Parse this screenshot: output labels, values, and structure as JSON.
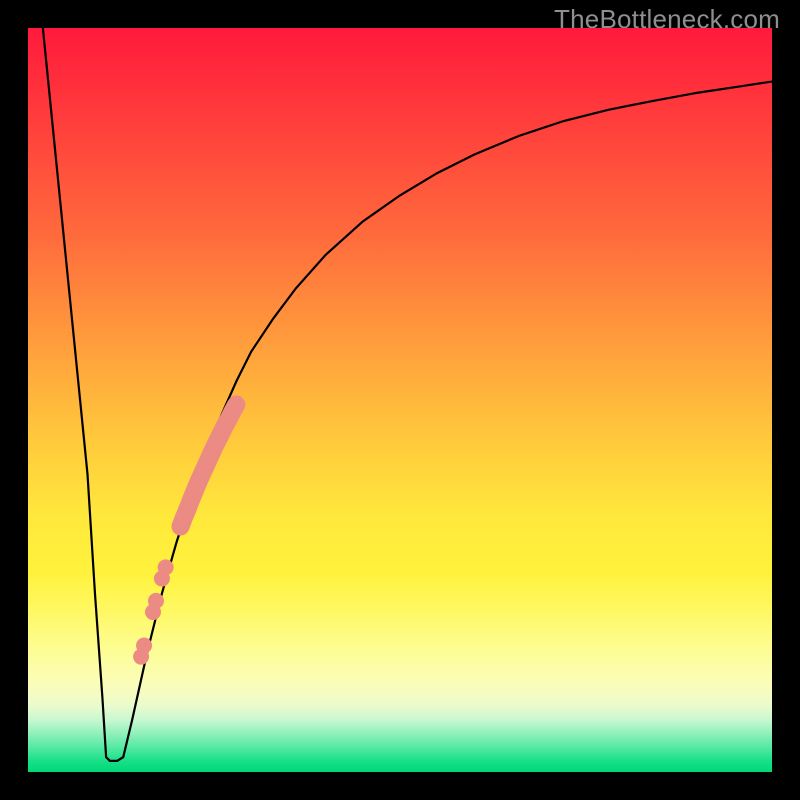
{
  "watermark": "TheBottleneck.com",
  "colors": {
    "curve": "#000000",
    "dot": "#eb8b84",
    "gradient_top": "#ff1a3c",
    "gradient_bottom": "#00d878",
    "frame": "#000000"
  },
  "chart_data": {
    "type": "line",
    "title": "",
    "xlabel": "",
    "ylabel": "",
    "xlim": [
      0,
      100
    ],
    "ylim": [
      0,
      100
    ],
    "grid": false,
    "legend": false,
    "annotations": [
      "TheBottleneck.com"
    ],
    "series": [
      {
        "name": "bottleneck-curve",
        "x": [
          2,
          4,
          6,
          8,
          9,
          10,
          10.5,
          11,
          12,
          12.8,
          14,
          16,
          18,
          20,
          22,
          24,
          26,
          28,
          30,
          33,
          36,
          40,
          45,
          50,
          55,
          60,
          66,
          72,
          78,
          84,
          90,
          96,
          100
        ],
        "y": [
          100,
          80,
          60,
          40,
          24,
          10,
          2,
          1.5,
          1.5,
          2,
          7,
          16,
          24,
          31,
          37,
          43,
          48,
          52.5,
          56.5,
          61,
          65,
          69.5,
          74,
          77.5,
          80.5,
          83,
          85.5,
          87.5,
          89,
          90.2,
          91.3,
          92.2,
          92.8
        ]
      },
      {
        "name": "salmon-dots-dense-segment",
        "x": [
          20.5,
          21.0,
          21.5,
          22.0,
          22.5,
          23.0,
          23.5,
          24.0,
          24.5,
          25.0,
          25.5,
          26.0,
          26.5,
          27.0,
          27.5,
          28.0
        ],
        "y": [
          33.0,
          34.3,
          35.5,
          36.8,
          38.0,
          39.2,
          40.3,
          41.4,
          42.5,
          43.6,
          44.6,
          45.6,
          46.6,
          47.5,
          48.5,
          49.4
        ]
      },
      {
        "name": "salmon-dots-sparse",
        "x": [
          18.0,
          18.5,
          16.8,
          17.2,
          15.2,
          15.6
        ],
        "y": [
          26.0,
          27.5,
          21.5,
          23.0,
          15.5,
          17.0
        ]
      }
    ]
  }
}
